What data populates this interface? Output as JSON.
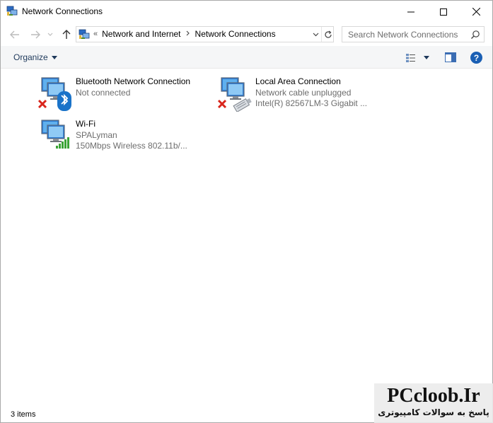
{
  "window": {
    "title": "Network Connections",
    "icon": "network-connections-icon"
  },
  "nav": {
    "crumb_start": "«",
    "breadcrumbs": [
      "Network and Internet",
      "Network Connections"
    ],
    "search_placeholder": "Search Network Connections"
  },
  "toolbar": {
    "organize_label": "Organize"
  },
  "items": [
    {
      "name": "Bluetooth Network Connection",
      "status": "Not connected",
      "device": "",
      "icon": "bluetooth-network-icon",
      "overlay": "disconnected-x-icon"
    },
    {
      "name": "Local Area Connection",
      "status": "Network cable unplugged",
      "device": "Intel(R) 82567LM-3 Gigabit ...",
      "icon": "ethernet-network-icon",
      "overlay": "disconnected-x-icon"
    },
    {
      "name": "Wi-Fi",
      "status": "SPALyman",
      "device": "150Mbps Wireless 802.11b/...",
      "icon": "wifi-network-icon",
      "overlay": "signal-bars-icon"
    }
  ],
  "status": {
    "item_count": "3 items"
  },
  "watermark": {
    "brand": "PCcloob.Ir",
    "tagline": "پاسخ به سوالات کامپیوتری"
  },
  "colors": {
    "accent": "#1a5fb4",
    "command_bar_bg": "#f5f6f7",
    "disconnected_red": "#d9261c",
    "signal_green": "#3aa335"
  }
}
